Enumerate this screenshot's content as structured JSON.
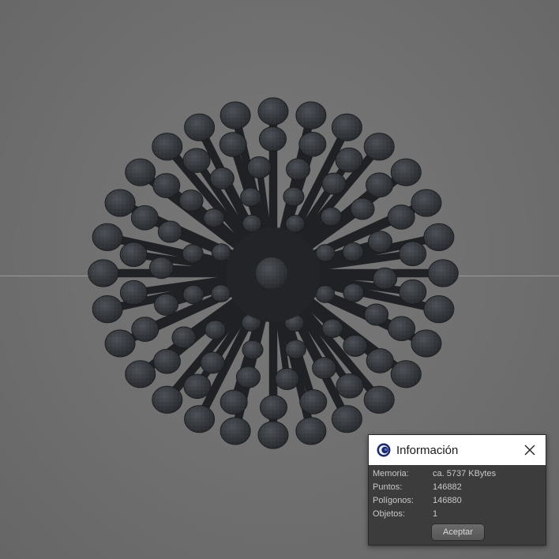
{
  "dialog": {
    "title": "Información",
    "icon": "cinema4d-app-icon",
    "close_icon": "close-icon",
    "rows": [
      {
        "label": "Memoria:",
        "value": "ca. 5737 KBytes"
      },
      {
        "label": "Puntos:",
        "value": "146882"
      },
      {
        "label": "Polígonos:",
        "value": "146880"
      },
      {
        "label": "Objetos:",
        "value": "1"
      }
    ],
    "accept_label": "Aceptar"
  },
  "viewport": {
    "object": "spiky-sphere-mesh",
    "background_color": "#6e6e6e",
    "mesh_color": "#2c2f33",
    "horizon_color": "#9a9a9a"
  }
}
